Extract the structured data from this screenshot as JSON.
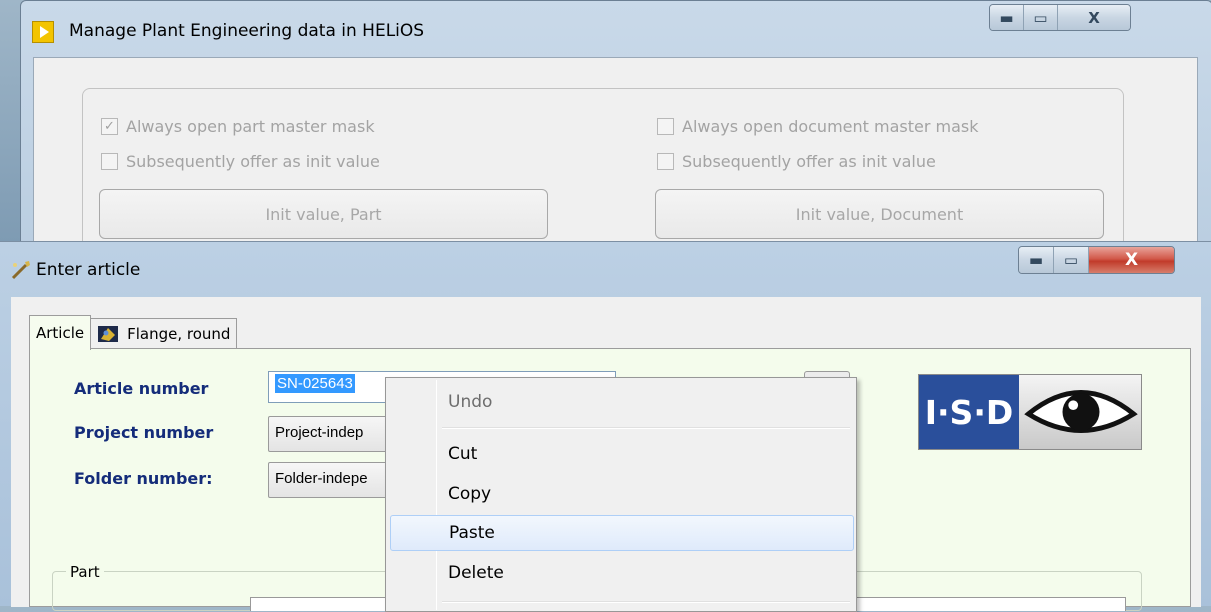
{
  "back_window": {
    "title": "Manage Plant Engineering data in HELiOS",
    "caption": {
      "minimize": "▬",
      "maximize": "▭",
      "close": "X"
    },
    "options": {
      "always_open_part": {
        "label": "Always open part master mask",
        "checked": true
      },
      "subsequently_part": {
        "label": "Subsequently offer as init value",
        "checked": false
      },
      "always_open_doc": {
        "label": "Always open document master mask",
        "checked": false
      },
      "subsequently_doc": {
        "label": "Subsequently offer as init value",
        "checked": false
      },
      "init_part_button": "Init value, Part",
      "init_doc_button": "Init value, Document"
    }
  },
  "front_window": {
    "title": "Enter article",
    "caption": {
      "minimize": "▬",
      "maximize": "▭",
      "close": "X"
    },
    "tabs": [
      {
        "label": "Article",
        "active": true
      },
      {
        "label": "Flange, round",
        "active": false
      }
    ],
    "fields": {
      "article_number": {
        "label": "Article number",
        "value": "SN-025643"
      },
      "project_number": {
        "label": "Project number",
        "value": "Project-indep"
      },
      "folder_number": {
        "label": "Folder number:",
        "value": "Folder-indepe"
      }
    },
    "logo_text": "I·S·D",
    "part_group": "Part"
  },
  "context_menu": {
    "items": [
      {
        "label": "Undo",
        "disabled": true
      },
      {
        "label": "Cut",
        "disabled": false
      },
      {
        "label": "Copy",
        "disabled": false
      },
      {
        "label": "Paste",
        "disabled": false,
        "hover": true
      },
      {
        "label": "Delete",
        "disabled": false
      }
    ]
  }
}
